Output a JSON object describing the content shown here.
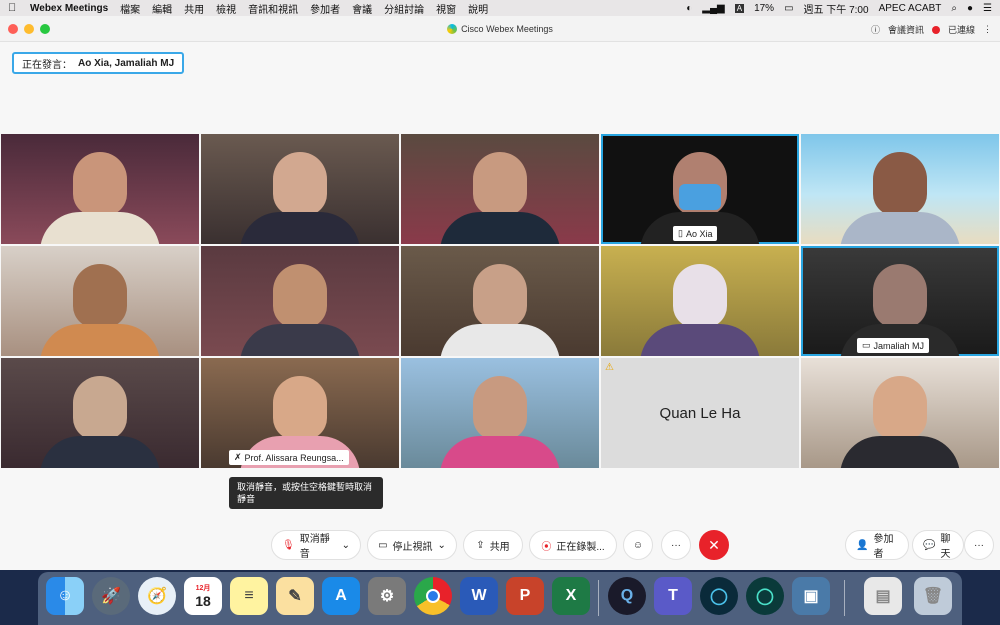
{
  "menubar": {
    "app_name": "Webex Meetings",
    "items": [
      "檔案",
      "編輯",
      "共用",
      "檢視",
      "音訊和視訊",
      "參加者",
      "會議",
      "分組討論",
      "視窗",
      "說明"
    ],
    "battery": "17%",
    "clock": "週五 下午 7:00",
    "user": "APEC ACABT"
  },
  "window": {
    "title": "Cisco Webex Meetings",
    "meeting_info_label": "會議資訊",
    "connected_label": "已連線"
  },
  "speaking": {
    "label": "正在發言：",
    "names": "Ao Xia, Jamaliah MJ"
  },
  "tiles": {
    "ao_xia": "Ao Xia",
    "jamaliah": "Jamaliah MJ",
    "alissara": "Prof. Alissara Reungsa...",
    "quan": "Quan Le Ha"
  },
  "tooltip": "取消靜音，或按住空格鍵暫時取消靜音",
  "controls": {
    "unmute": "取消靜音",
    "stop_video": "停止視訊",
    "share": "共用",
    "recording": "正在錄製...",
    "participants": "參加者",
    "chat": "聊天",
    "more": "···"
  },
  "dock": {
    "calendar_month": "12月",
    "calendar_day": "18"
  }
}
